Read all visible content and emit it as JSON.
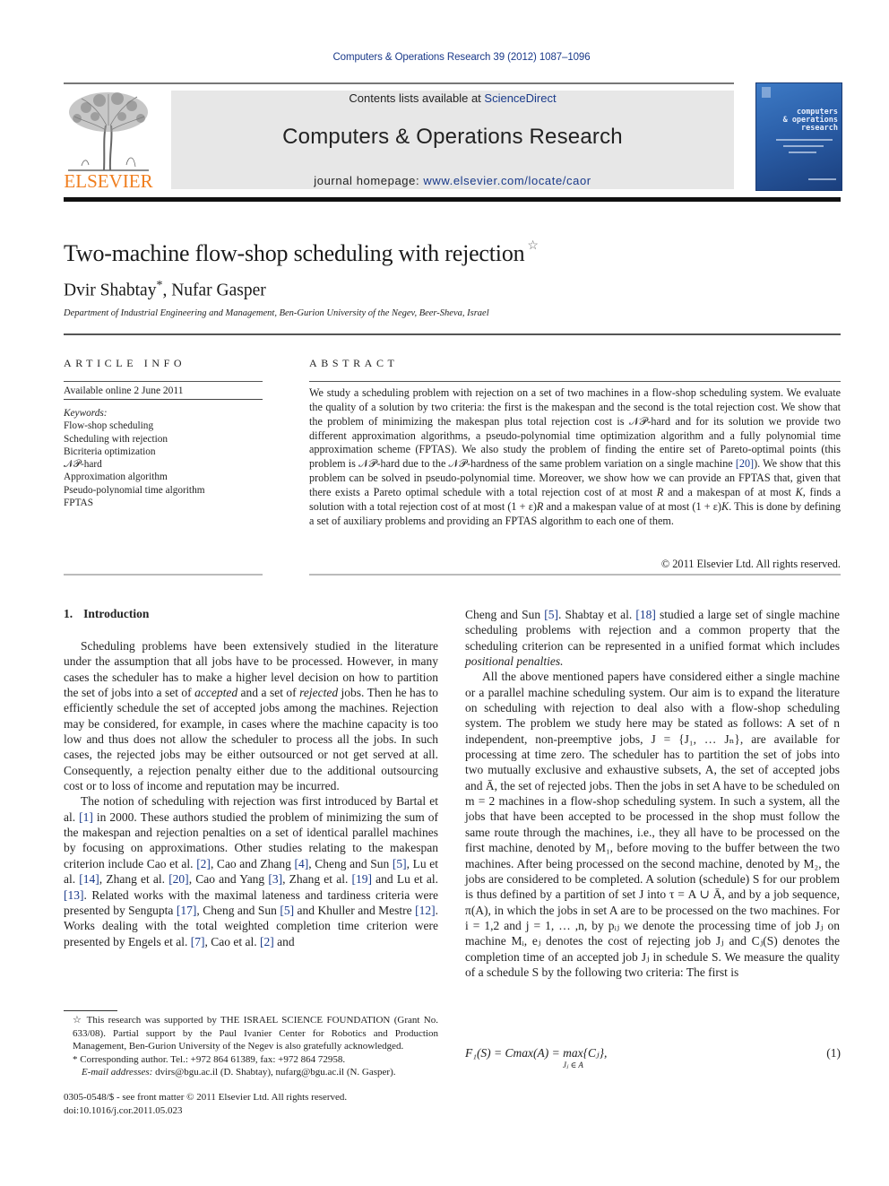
{
  "header": {
    "journal_ref": "Computers & Operations Research 39 (2012) 1087–1096",
    "contents_prefix": "Contents lists available at ",
    "contents_link": "ScienceDirect",
    "journal_name": "Computers & Operations Research",
    "homepage_prefix": "journal homepage: ",
    "homepage_link": "www.elsevier.com/locate/caor",
    "publisher_logo_text": "ELSEVIER",
    "cover": {
      "title_lines": [
        "computers",
        "& operations",
        "research"
      ]
    },
    "colors": {
      "link": "#1a3a8a",
      "publisher_orange": "#f07e1e",
      "header_box": "#e7e7e7",
      "cover_blue": "#2b5fa9"
    }
  },
  "article": {
    "title": "Two-machine flow-shop scheduling with rejection",
    "title_marker": "☆",
    "authors": [
      {
        "name": "Dvir Shabtay",
        "marker": "*"
      },
      {
        "name": "Nufar Gasper",
        "marker": ""
      }
    ],
    "author_separator": ", ",
    "affiliation": "Department of Industrial Engineering and Management, Ben-Gurion University of the Negev, Beer-Sheva, Israel"
  },
  "article_info": {
    "heading": "ARTICLE INFO",
    "available_online": "Available online 2 June 2011",
    "keywords_label": "Keywords:",
    "keywords": [
      "Flow-shop scheduling",
      "Scheduling with rejection",
      "Bicriteria optimization",
      "𝒩𝒫-hard",
      "Approximation algorithm",
      "Pseudo-polynomial time algorithm",
      "FPTAS"
    ]
  },
  "abstract": {
    "heading": "ABSTRACT",
    "segments": [
      "We study a scheduling problem with rejection on a set of two machines in a flow-shop scheduling system. We evaluate the quality of a solution by two criteria: the first is the makespan and the second is the total rejection cost. We show that the problem of minimizing the makespan plus total rejection cost is 𝒩𝒫-hard and for its solution we provide two different approximation algorithms, a pseudo-polynomial time optimization algorithm and a fully polynomial time approximation scheme (FPTAS). We also study the problem of finding the entire set of Pareto-optimal points (this problem is 𝒩𝒫-hard due to the 𝒩𝒫-hardness of the same problem variation on a single machine ",
      "[20]",
      "). We show that this problem can be solved in pseudo-polynomial time. Moreover, we show how we can provide an FPTAS that, given that there exists a Pareto optimal schedule with a total rejection cost of at most ",
      "R",
      " and a makespan of at most ",
      "K",
      ", finds a solution with a total rejection cost of at most (1 + ε)",
      "R",
      " and a makespan value of at most (1 + ε)",
      "K",
      ". This is done by defining a set of auxiliary problems and providing an FPTAS algorithm to each one of them."
    ],
    "copyright": "© 2011 Elsevier Ltd. All rights reserved."
  },
  "body": {
    "section": {
      "number": "1.",
      "title": "Introduction"
    },
    "left_paragraphs": {
      "p1": [
        "Scheduling problems have been extensively studied in the literature under the assumption that all jobs have to be processed. However, in many cases the scheduler has to make a higher level decision on how to partition the set of jobs into a set of ",
        "accepted",
        " and a set of ",
        "rejected",
        " jobs. Then he has to efficiently schedule the set of accepted jobs among the machines. Rejection may be considered, for example, in cases where the machine capacity is too low and thus does not allow the scheduler to process all the jobs. In such cases, the rejected jobs may be either outsourced or not get served at all. Consequently, a rejection penalty either due to the additional outsourcing cost or to loss of income and reputation may be incurred."
      ],
      "p2": [
        "The notion of scheduling with rejection was first introduced by Bartal et al. ",
        "[1]",
        " in 2000. These authors studied the problem of minimizing the sum of the makespan and rejection penalties on a set of identical parallel machines by focusing on approximations. Other studies relating to the makespan criterion include Cao et al. ",
        "[2]",
        ", Cao and Zhang ",
        "[4]",
        ", Cheng and Sun ",
        "[5]",
        ", Lu et al. ",
        "[14]",
        ", Zhang et al. ",
        "[20]",
        ", Cao and Yang ",
        "[3]",
        ", Zhang et al. ",
        "[19]",
        " and Lu et al. ",
        "[13]",
        ". Related works with the maximal lateness and tardiness criteria were presented by Sengupta ",
        "[17]",
        ", Cheng and Sun ",
        "[5]",
        " and Khuller and Mestre ",
        "[12]",
        ". Works dealing with the total weighted completion time criterion were presented by Engels et al. ",
        "[7]",
        ", Cao et al. ",
        "[2]",
        " and"
      ]
    },
    "right_paragraphs": {
      "p1": [
        "Cheng and Sun ",
        "[5]",
        ". Shabtay et al. ",
        "[18]",
        " studied a large set of single machine scheduling problems with rejection and a common property that the scheduling criterion can be represented in a unified format which includes ",
        "positional penalties."
      ],
      "p2": "All the above mentioned papers have considered either a single machine or a parallel machine scheduling system. Our aim is to expand the literature on scheduling with rejection to deal also with a flow-shop scheduling system. The problem we study here may be stated as follows: A set of n independent, non-preemptive jobs, J = {J₁, … Jₙ}, are available for processing at time zero. The scheduler has to partition the set of jobs into two mutually exclusive and exhaustive subsets, A, the set of accepted jobs and Ā, the set of rejected jobs. Then the jobs in set A have to be scheduled on m = 2 machines in a flow-shop scheduling system. In such a system, all the jobs that have been accepted to be processed in the shop must follow the same route through the machines, i.e., they all have to be processed on the first machine, denoted by M₁, before moving to the buffer between the two machines. After being processed on the second machine, denoted by M₂, the jobs are considered to be completed. A solution (schedule) S for our problem is thus defined by a partition of set J into τ = A ∪ Ā, and by a job sequence, π(A), in which the jobs in set A are to be processed on the two machines. For i = 1,2 and j = 1, … ,n, by pᵢⱼ we denote the processing time of job Jⱼ on machine Mᵢ, eⱼ denotes the cost of rejecting job Jⱼ and Cⱼ(S) denotes the completion time of an accepted job Jⱼ in schedule S. We measure the quality of a schedule S by the following two criteria: The first is"
    },
    "equation": {
      "text": "F₁(S) = Cmax(A) = max{Cⱼ},",
      "subscript": "Jⱼ ∈ A",
      "number": "(1)"
    }
  },
  "footnotes": {
    "star_note": "☆ This research was supported by THE ISRAEL SCIENCE FOUNDATION (Grant No. 633/08). Partial support by the Paul Ivanier Center for Robotics and Production Management, Ben-Gurion University of the Negev is also gratefully acknowledged.",
    "corresponding": "* Corresponding author. Tel.: +972 864 61389, fax: +972 864 72958.",
    "email_label": "E-mail addresses:",
    "email_text": " dvirs@bgu.ac.il (D. Shabtay), nufarg@bgu.ac.il (N. Gasper)."
  },
  "front_matter": {
    "issn_line": "0305-0548/$ - see front matter © 2011 Elsevier Ltd. All rights reserved.",
    "doi": "doi:10.1016/j.cor.2011.05.023"
  }
}
